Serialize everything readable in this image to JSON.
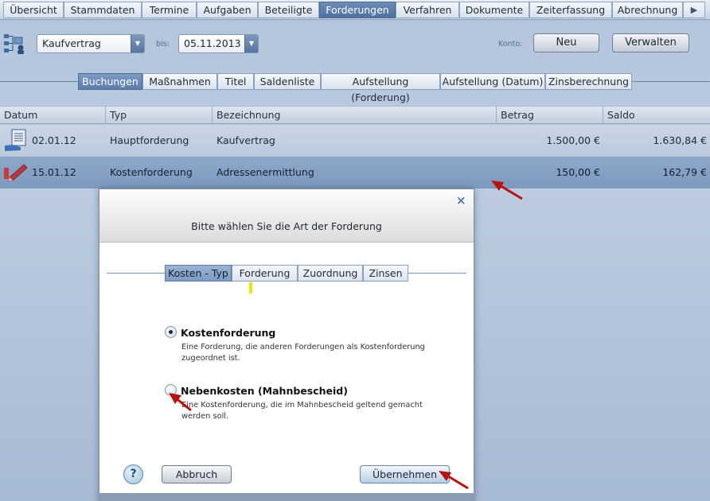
{
  "topnav": {
    "tabs": [
      {
        "label": "Übersicht",
        "active": false
      },
      {
        "label": "Stammdaten",
        "active": false
      },
      {
        "label": "Termine",
        "active": false
      },
      {
        "label": "Aufgaben",
        "active": false
      },
      {
        "label": "Beteiligte",
        "active": false
      },
      {
        "label": "Forderungen",
        "active": true
      },
      {
        "label": "Verfahren",
        "active": false
      },
      {
        "label": "Dokumente",
        "active": false
      },
      {
        "label": "Zeiterfassung",
        "active": false
      },
      {
        "label": "Abrechnung",
        "active": false
      }
    ],
    "more_icon": "play-triangle-icon"
  },
  "toolbar": {
    "contract_select": "Kaufvertrag",
    "bis_label": "bis:",
    "date_select": "05.11.2013",
    "konto_label": "Konto:",
    "new_button": "Neu",
    "manage_button": "Verwalten"
  },
  "subtabs": [
    {
      "label": "Buchungen",
      "active": true
    },
    {
      "label": "Maßnahmen",
      "active": false
    },
    {
      "label": "Titel",
      "active": false
    },
    {
      "label": "Saldenliste",
      "active": false
    },
    {
      "label": "Aufstellung (Forderung)",
      "active": false
    },
    {
      "label": "Aufstellung (Datum)",
      "active": false
    },
    {
      "label": "Zinsberechnung",
      "active": false
    }
  ],
  "table": {
    "columns": [
      "Datum",
      "Typ",
      "Bezeichnung",
      "Betrag",
      "Saldo"
    ],
    "rows": [
      {
        "icon": "document-hand-icon",
        "date": "02.01.12",
        "type": "Hauptforderung",
        "name": "Kaufvertrag",
        "amount": "1.500,00 €",
        "balance": "1.630,84 €",
        "selected": false
      },
      {
        "icon": "pencil-edit-icon",
        "date": "15.01.12",
        "type": "Kostenforderung",
        "name": "Adressenermittlung",
        "amount": "150,00 €",
        "balance": "162,79 €",
        "selected": true
      }
    ]
  },
  "dialog": {
    "title": "Bitte wählen Sie die Art der Forderung",
    "close": "×",
    "tabs": [
      {
        "label": "Kosten - Typ",
        "active": true
      },
      {
        "label": "Forderung",
        "active": false
      },
      {
        "label": "Zuordnung",
        "active": false
      },
      {
        "label": "Zinsen",
        "active": false
      }
    ],
    "options": [
      {
        "title": "Kostenforderung",
        "desc_line1": "Eine Forderung, die anderen Forderungen als Kostenforderung",
        "desc_line2": "zugeordnet ist.",
        "selected": true
      },
      {
        "title": "Nebenkosten (Mahnbescheid)",
        "desc_line1": "Eine Kostenforderung, die im Mahnbescheid geltend gemacht",
        "desc_line2": "werden soll.",
        "selected": false
      }
    ],
    "help": "?",
    "cancel_button": "Abbruch",
    "apply_button": "Übernehmen"
  },
  "colors": {
    "accent_active_tab": "#4f71a0",
    "selected_row": "#8ea7ca",
    "annotation_arrow": "#b3140f"
  }
}
